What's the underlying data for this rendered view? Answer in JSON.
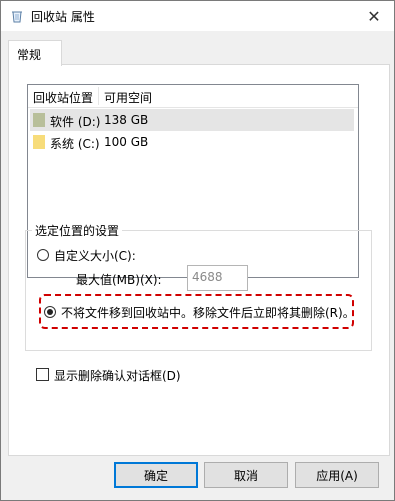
{
  "window": {
    "title": "回收站 属性",
    "close_glyph": "✕"
  },
  "tabs": [
    {
      "label": "常规"
    }
  ],
  "drive_list": {
    "headers": [
      "回收站位置",
      "可用空间"
    ],
    "rows": [
      {
        "name": "软件 (D:)",
        "space": "138 GB",
        "icon_color": "#b8bf9a",
        "selected": true
      },
      {
        "name": "系统 (C:)",
        "space": "100 GB",
        "icon_color": "#f7dc7a",
        "selected": false
      }
    ]
  },
  "settings": {
    "label": "选定位置的设置",
    "custom_size_label": "自定义大小(C):",
    "max_value_label": "最大值(MB)(X):",
    "max_value": "4688",
    "delete_immediately_label": "不将文件移到回收站中。移除文件后立即将其删除(R)。",
    "selected_option": "delete_immediately"
  },
  "confirm_dialog_label": "显示删除确认对话框(D)",
  "confirm_dialog_checked": false,
  "buttons": {
    "ok": "确定",
    "cancel": "取消",
    "apply": "应用(A)"
  },
  "colors": {
    "highlight": "#d00000",
    "default_button_border": "#0078d7"
  }
}
